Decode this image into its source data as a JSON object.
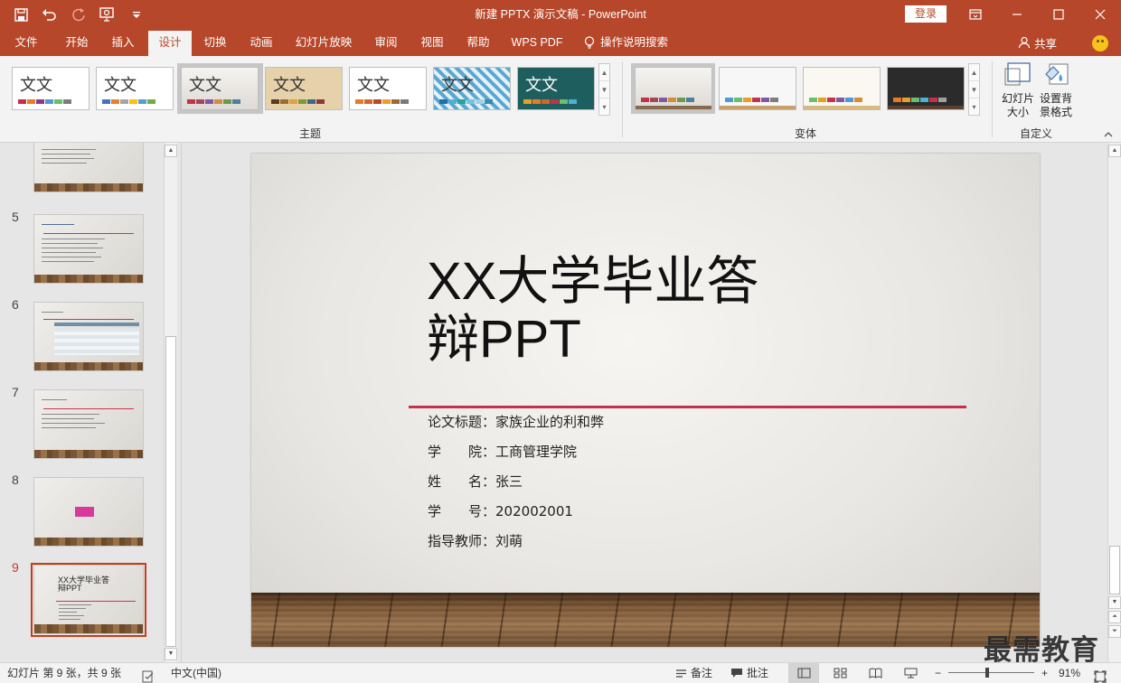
{
  "window": {
    "title": "新建 PPTX 演示文稿 - PowerPoint",
    "login_label": "登录"
  },
  "tabs": [
    {
      "label": "文件",
      "active": false
    },
    {
      "label": "开始",
      "active": false
    },
    {
      "label": "插入",
      "active": false
    },
    {
      "label": "设计",
      "active": true
    },
    {
      "label": "切换",
      "active": false
    },
    {
      "label": "动画",
      "active": false
    },
    {
      "label": "幻灯片放映",
      "active": false
    },
    {
      "label": "审阅",
      "active": false
    },
    {
      "label": "视图",
      "active": false
    },
    {
      "label": "帮助",
      "active": false
    },
    {
      "label": "WPS PDF",
      "active": false
    }
  ],
  "search_tell": "操作说明搜索",
  "share_label": "共享",
  "ribbon": {
    "themes_group_label": "主题",
    "variants_group_label": "变体",
    "customize_group_label": "自定义",
    "theme_sample_text": "文文",
    "slide_size_label": "幻灯片\n大小",
    "format_bg_label": "设置背\n景格式",
    "colors": {
      "accent_red": "#b7472a",
      "slide_rule": "#c4314b"
    }
  },
  "thumbnails": {
    "numbers": [
      "5",
      "6",
      "7",
      "8",
      "9"
    ],
    "active_number": "9"
  },
  "slide": {
    "title_line1": "XX大学毕业答",
    "title_line2": "辩PPT",
    "info": [
      {
        "label": "论文标题：",
        "value": "家族企业的利和弊"
      },
      {
        "label": "学　　院：",
        "value": "工商管理学院"
      },
      {
        "label": "姓　　名：",
        "value": "张三"
      },
      {
        "label": "学　　号：",
        "value": "202002001"
      },
      {
        "label": "指导教师：",
        "value": "刘萌"
      }
    ]
  },
  "status": {
    "slide_info": "幻灯片 第 9 张，共 9 张",
    "language": "中文(中国)",
    "notes_label": "备注",
    "comments_label": "批注",
    "zoom": "91%"
  },
  "watermark": "最需教育"
}
